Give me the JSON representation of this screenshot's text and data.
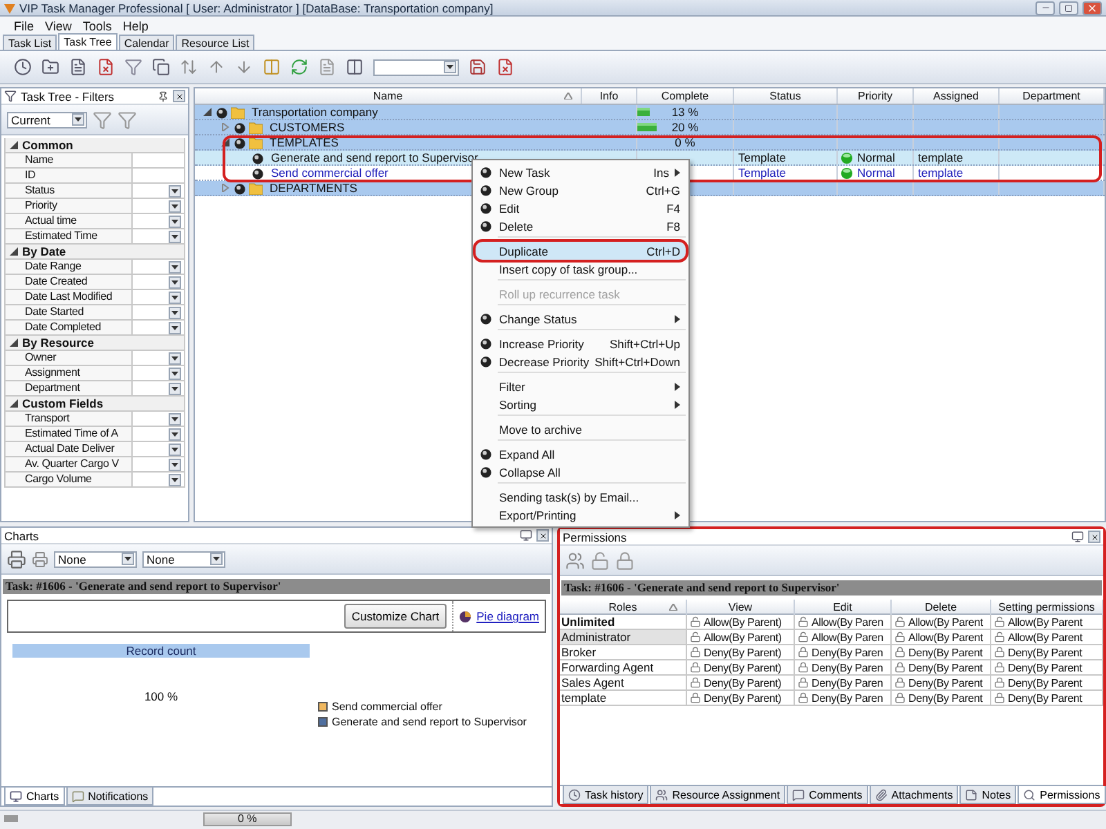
{
  "window": {
    "title": "VIP Task Manager Professional [ User: Administrator ] [DataBase: Transportation company]"
  },
  "menu": [
    "File",
    "View",
    "Tools",
    "Help"
  ],
  "tabs": [
    {
      "label": "Task List",
      "selected": false
    },
    {
      "label": "Task Tree",
      "selected": true
    },
    {
      "label": "Calendar",
      "selected": false
    },
    {
      "label": "Resource List",
      "selected": false
    }
  ],
  "filters": {
    "title": "Task Tree - Filters",
    "preset": "Current",
    "groups": [
      {
        "label": "Common",
        "expanded": true,
        "items": [
          {
            "label": "Name",
            "dropdown": false
          },
          {
            "label": "ID",
            "dropdown": false
          },
          {
            "label": "Status",
            "dropdown": true
          },
          {
            "label": "Priority",
            "dropdown": true
          },
          {
            "label": "Actual time",
            "dropdown": true
          },
          {
            "label": "Estimated Time",
            "dropdown": true
          }
        ]
      },
      {
        "label": "By Date",
        "expanded": true,
        "items": [
          {
            "label": "Date Range",
            "dropdown": true
          },
          {
            "label": "Date Created",
            "dropdown": true
          },
          {
            "label": "Date Last Modified",
            "dropdown": true
          },
          {
            "label": "Date Started",
            "dropdown": true
          },
          {
            "label": "Date Completed",
            "dropdown": true
          }
        ]
      },
      {
        "label": "By Resource",
        "expanded": true,
        "items": [
          {
            "label": "Owner",
            "dropdown": true
          },
          {
            "label": "Assignment",
            "dropdown": true
          },
          {
            "label": "Department",
            "dropdown": true
          }
        ]
      },
      {
        "label": "Custom Fields",
        "expanded": true,
        "items": [
          {
            "label": "Transport",
            "dropdown": true
          },
          {
            "label": "Estimated Time of A",
            "dropdown": true
          },
          {
            "label": "Actual Date Deliver",
            "dropdown": true
          },
          {
            "label": "Av. Quarter Cargo V",
            "dropdown": true
          },
          {
            "label": "Cargo Volume",
            "dropdown": true
          }
        ]
      }
    ]
  },
  "tree": {
    "columns": [
      "Name",
      "Info",
      "Complete",
      "Status",
      "Priority",
      "Assigned",
      "Department"
    ],
    "rows": [
      {
        "name": "Transportation company",
        "kind": "group",
        "expanded": true,
        "complete": "13 %",
        "level": 0.13,
        "children": [
          {
            "name": "CUSTOMERS",
            "kind": "group",
            "expanded": false,
            "complete": "20 %",
            "level": 0.2
          },
          {
            "name": "TEMPLATES",
            "kind": "group",
            "expanded": true,
            "complete": "0 %",
            "children": [
              {
                "name": "Generate and send report to Supervisor",
                "kind": "task",
                "selected": true,
                "status": "Template",
                "priority": "Normal",
                "assigned": "template"
              },
              {
                "name": "Send commercial offer",
                "kind": "task",
                "selected": false,
                "status": "Template",
                "priority": "Normal",
                "assigned": "template"
              }
            ]
          },
          {
            "name": "DEPARTMENTS",
            "kind": "group",
            "expanded": false
          }
        ]
      }
    ]
  },
  "context_menu": [
    {
      "kind": "icon",
      "label": "New Task",
      "shortcut": "Ins",
      "submenu": true,
      "disabled": false,
      "selected": false
    },
    {
      "kind": "icon",
      "label": "New Group",
      "shortcut": "Ctrl+G",
      "submenu": false,
      "disabled": false,
      "selected": false
    },
    {
      "kind": "icon",
      "label": "Edit",
      "shortcut": "F4",
      "submenu": false,
      "disabled": false,
      "selected": false
    },
    {
      "kind": "icon",
      "label": "Delete",
      "shortcut": "F8",
      "submenu": false,
      "disabled": false,
      "selected": false
    },
    {
      "kind": "separator"
    },
    {
      "kind": "plain",
      "label": "Duplicate",
      "shortcut": "Ctrl+D",
      "submenu": false,
      "disabled": false,
      "selected": true
    },
    {
      "kind": "plain",
      "label": "Insert copy of task group...",
      "submenu": false,
      "disabled": false,
      "selected": false
    },
    {
      "kind": "separator"
    },
    {
      "kind": "plain",
      "label": "Roll up recurrence task",
      "submenu": false,
      "disabled": true,
      "selected": false
    },
    {
      "kind": "separator"
    },
    {
      "kind": "icon",
      "label": "Change Status",
      "submenu": true,
      "disabled": false,
      "selected": false
    },
    {
      "kind": "separator"
    },
    {
      "kind": "icon",
      "label": "Increase Priority",
      "shortcut": "Shift+Ctrl+Up",
      "submenu": false,
      "disabled": false,
      "selected": false
    },
    {
      "kind": "icon",
      "label": "Decrease Priority",
      "shortcut": "Shift+Ctrl+Down",
      "submenu": false,
      "disabled": false,
      "selected": false
    },
    {
      "kind": "separator"
    },
    {
      "kind": "plain",
      "label": "Filter",
      "submenu": true,
      "disabled": false,
      "selected": false
    },
    {
      "kind": "plain",
      "label": "Sorting",
      "submenu": true,
      "disabled": false,
      "selected": false
    },
    {
      "kind": "separator"
    },
    {
      "kind": "plain",
      "label": "Move to archive",
      "submenu": false,
      "disabled": false,
      "selected": false
    },
    {
      "kind": "separator"
    },
    {
      "kind": "icon",
      "label": "Expand All",
      "submenu": false,
      "disabled": false,
      "selected": false
    },
    {
      "kind": "icon",
      "label": "Collapse All",
      "submenu": false,
      "disabled": false,
      "selected": false
    },
    {
      "kind": "separator"
    },
    {
      "kind": "plain",
      "label": "Sending task(s) by Email...",
      "submenu": false,
      "disabled": false,
      "selected": false
    },
    {
      "kind": "plain",
      "label": "Export/Printing",
      "submenu": true,
      "disabled": false,
      "selected": false
    }
  ],
  "charts": {
    "title": "Charts",
    "combos": [
      "None",
      "None"
    ],
    "task": "Task: #1606 - 'Generate and send report to Supervisor'",
    "button": "Customize Chart",
    "link": "Pie diagram",
    "header": "Record count",
    "value": "100 %",
    "legend": [
      {
        "label": "Send commercial offer",
        "color": "#f0b860"
      },
      {
        "label": "Generate and send report to Supervisor",
        "color": "#4f6f9f"
      }
    ],
    "tabs": [
      {
        "label": "Charts",
        "selected": true
      },
      {
        "label": "Notifications",
        "selected": false
      }
    ]
  },
  "permissions": {
    "title": "Permissions",
    "task": "Task: #1606 - 'Generate and send report to Supervisor'",
    "columns": [
      "Roles",
      "View",
      "Edit",
      "Delete",
      "Setting permissions"
    ],
    "rows": [
      {
        "kind": "builtin",
        "selected": false,
        "cells": [
          {
            "kind": "role",
            "text": "Unlimited"
          },
          {
            "kind": "allow",
            "text": "Allow(By Parent)"
          },
          {
            "kind": "allow",
            "text": "Allow(By Paren"
          },
          {
            "kind": "allow",
            "text": "Allow(By Parent"
          },
          {
            "kind": "allow",
            "text": "Allow(By Parent"
          }
        ]
      },
      {
        "kind": "role",
        "selected": true,
        "cells": [
          {
            "kind": "role",
            "text": "Administrator"
          },
          {
            "kind": "allow",
            "text": "Allow(By Parent)"
          },
          {
            "kind": "allow",
            "text": "Allow(By Paren"
          },
          {
            "kind": "allow",
            "text": "Allow(By Parent"
          },
          {
            "kind": "allow",
            "text": "Allow(By Parent"
          }
        ]
      },
      {
        "kind": "role",
        "selected": false,
        "cells": [
          {
            "kind": "role",
            "text": "Broker"
          },
          {
            "kind": "deny",
            "text": "Deny(By Parent)"
          },
          {
            "kind": "deny",
            "text": "Deny(By Paren"
          },
          {
            "kind": "deny",
            "text": "Deny(By Parent"
          },
          {
            "kind": "deny",
            "text": "Deny(By Parent"
          }
        ]
      },
      {
        "kind": "role",
        "selected": false,
        "cells": [
          {
            "kind": "role",
            "text": "Forwarding Agent"
          },
          {
            "kind": "deny",
            "text": "Deny(By Parent)"
          },
          {
            "kind": "deny",
            "text": "Deny(By Paren"
          },
          {
            "kind": "deny",
            "text": "Deny(By Parent"
          },
          {
            "kind": "deny",
            "text": "Deny(By Parent"
          }
        ]
      },
      {
        "kind": "role",
        "selected": false,
        "cells": [
          {
            "kind": "role",
            "text": "Sales Agent"
          },
          {
            "kind": "deny",
            "text": "Deny(By Parent)"
          },
          {
            "kind": "deny",
            "text": "Deny(By Paren"
          },
          {
            "kind": "deny",
            "text": "Deny(By Parent"
          },
          {
            "kind": "deny",
            "text": "Deny(By Parent"
          }
        ]
      },
      {
        "kind": "role",
        "selected": false,
        "cells": [
          {
            "kind": "role",
            "text": "template"
          },
          {
            "kind": "deny",
            "text": "Deny(By Parent)"
          },
          {
            "kind": "deny",
            "text": "Deny(By Paren"
          },
          {
            "kind": "deny",
            "text": "Deny(By Parent"
          },
          {
            "kind": "deny",
            "text": "Deny(By Parent"
          }
        ]
      }
    ],
    "tabs": [
      {
        "label": "Task history",
        "selected": false
      },
      {
        "label": "Resource Assignment",
        "selected": false
      },
      {
        "label": "Comments",
        "selected": false
      },
      {
        "label": "Attachments",
        "selected": false
      },
      {
        "label": "Notes",
        "selected": false
      },
      {
        "label": "Permissions",
        "selected": true
      }
    ]
  },
  "status_bar": {
    "progress": "0 %",
    "level": 0
  }
}
